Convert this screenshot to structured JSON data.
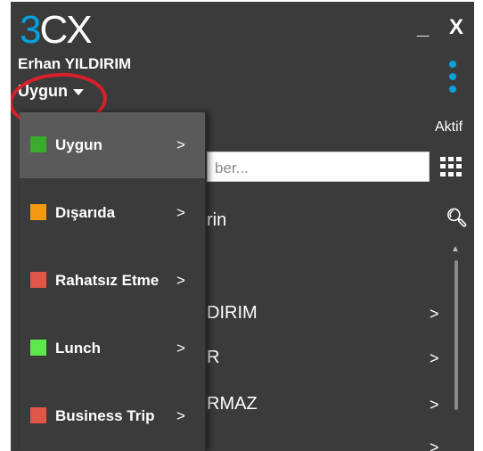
{
  "app": {
    "logo_3": "3",
    "logo_cx": "CX",
    "minimize_label": "_",
    "close_label": "X"
  },
  "user": {
    "name": "Erhan YILDIRIM",
    "status": "Uygun"
  },
  "header": {
    "aktif": "Aktif"
  },
  "search": {
    "placeholder_visible": "ber..."
  },
  "list": {
    "header_fragment": "rin",
    "contacts": [
      {
        "text": "DIRIM",
        "arrow": ">"
      },
      {
        "text": "R",
        "arrow": ">"
      },
      {
        "text": "RMAZ",
        "arrow": ">"
      },
      {
        "text": "",
        "arrow": ">"
      }
    ]
  },
  "status_menu": {
    "items": [
      {
        "label": "Uygun",
        "color": "#3aab2a",
        "arrow": ">",
        "selected": true
      },
      {
        "label": "Dışarıda",
        "color": "#f39a12",
        "arrow": ">",
        "selected": false
      },
      {
        "label": "Rahatsız Etme",
        "color": "#e0574a",
        "arrow": ">",
        "selected": false
      },
      {
        "label": "Lunch",
        "color": "#5ee84d",
        "arrow": ">",
        "selected": false
      },
      {
        "label": "Business Trip",
        "color": "#e0574a",
        "arrow": ">",
        "selected": false
      }
    ]
  },
  "icons": {
    "kebab": "more-vertical-icon",
    "dialpad": "dialpad-icon",
    "search": "search-icon"
  }
}
